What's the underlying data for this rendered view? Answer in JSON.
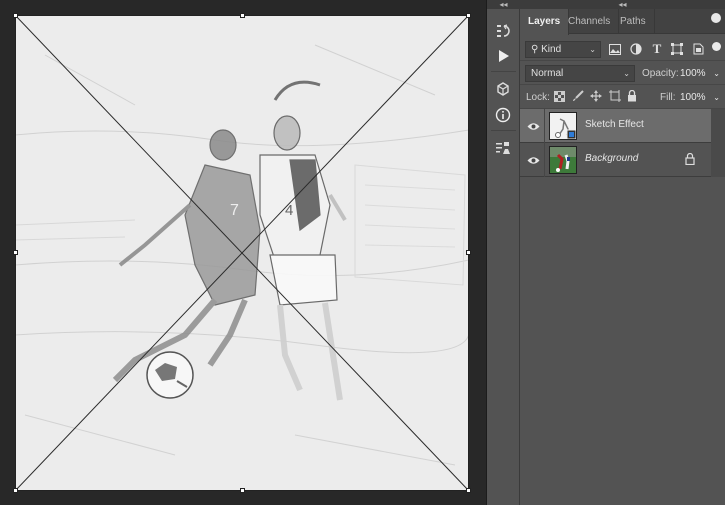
{
  "panel": {
    "tabs": [
      {
        "label": "Layers",
        "active": true
      },
      {
        "label": "Channels",
        "active": false
      },
      {
        "label": "Paths",
        "active": false
      }
    ],
    "filter": {
      "kind_label": "Kind",
      "icons": [
        "image-filter-icon",
        "adjustment-filter-icon",
        "type-filter-icon",
        "shape-filter-icon",
        "smart-object-filter-icon"
      ]
    },
    "blend_mode": "Normal",
    "opacity_label": "Opacity:",
    "opacity_value": "100%",
    "lock_label": "Lock:",
    "fill_label": "Fill:",
    "fill_value": "100%",
    "layers": [
      {
        "name": "Sketch Effect",
        "selected": true,
        "visible": true,
        "locked": false
      },
      {
        "name": "Background",
        "selected": false,
        "visible": true,
        "locked": true
      }
    ]
  },
  "tools": [
    "history-icon",
    "play-actions-icon",
    "3d-icon",
    "info-icon",
    "properties-icon"
  ],
  "colors": {
    "panel_bg": "#535353",
    "canvas_bg": "#282828",
    "selected_layer": "#6c6c6c",
    "artboard": "#ececec"
  }
}
